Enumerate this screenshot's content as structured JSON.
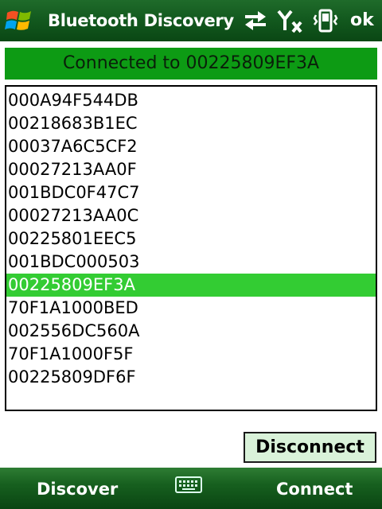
{
  "titlebar": {
    "title": "Bluetooth Discovery Demo",
    "ok_label": "ok",
    "icons": [
      "windows-start-icon",
      "data-connection-icon",
      "signal-no-service-icon",
      "phone-vibrate-icon"
    ]
  },
  "status": {
    "text": "Connected to 00225809EF3A"
  },
  "devices": {
    "items": [
      "000A94F544DB",
      "00218683B1EC",
      "00037A6C5CF2",
      "00027213AA0F",
      "001BDC0F47C7",
      "00027213AA0C",
      "00225801EEC5",
      "001BDC000503",
      "00225809EF3A",
      "70F1A1000BED",
      "002556DC560A",
      "70F1A1000F5F",
      "00225809DF6F"
    ],
    "selected": "00225809EF3A"
  },
  "actions": {
    "disconnect_label": "Disconnect"
  },
  "softkeys": {
    "left_label": "Discover",
    "right_label": "Connect",
    "center_icon": "keyboard-icon"
  },
  "colors": {
    "titlebar": "#135a1f",
    "banner": "#0d9b14",
    "selection": "#33cc33",
    "button_bg": "#d9f2d9"
  }
}
